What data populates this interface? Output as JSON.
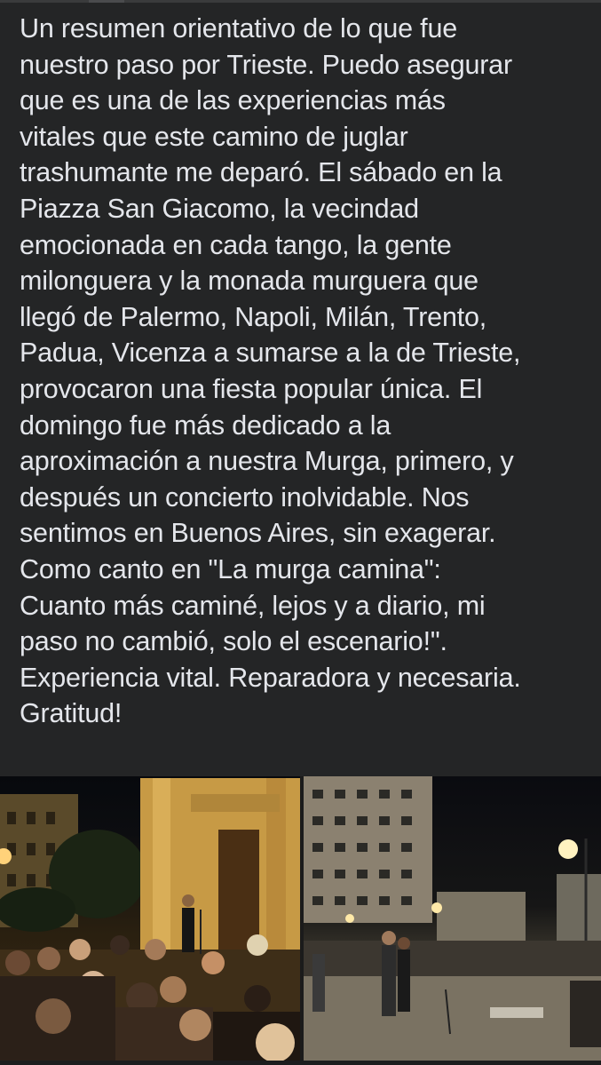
{
  "post": {
    "text": "Un resumen orientativo de lo que fue\nnuestro paso por Trieste. Puedo asegurar\nque es una de las experiencias más\nvitales que este camino de juglar\ntrashumante me deparó. El sábado en la\nPiazza San Giacomo, la vecindad\nemocionada en cada tango, la gente\nmilonguera y la monada murguera que\nllegó de Palermo, Napoli, Milán, Trento,\nPadua, Vicenza a sumarse a la de Trieste,\nprovocaron una fiesta popular única. El\ndomingo fue más dedicado a la\naproximación a nuestra Murga, primero, y\ndespués un concierto inolvidable. Nos\nsentimos en Buenos Aires, sin exagerar.\nComo canto en \"La murga camina\":\nCuanto más caminé, lejos y a diario, mi\npaso no cambió, solo el escenario!\".\nExperiencia vital. Reparadora y necesaria.\nGratitud!"
  },
  "photos": [
    {
      "subject": "concert-in-front-of-church-at-night"
    },
    {
      "subject": "tango-dancers-in-square-at-night"
    }
  ],
  "colors": {
    "background": "#242526",
    "text": "#e4e6eb"
  }
}
